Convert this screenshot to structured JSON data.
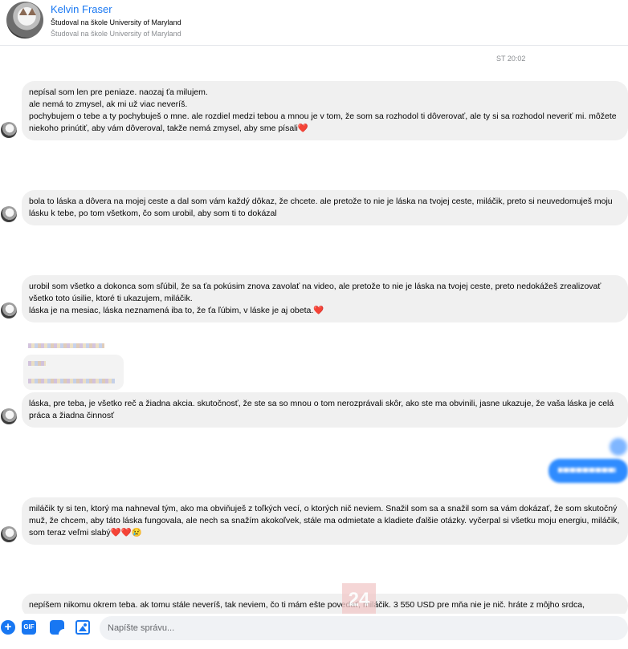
{
  "header": {
    "name": "Kelvin Fraser",
    "subtitle": "Študoval na škole University of Maryland",
    "subtitle_secondary": "Študoval na škole University of Maryland"
  },
  "timestamp": "ST 20:02",
  "messages": [
    {
      "lines": [
        "nepísal som len pre peniaze. naozaj ťa milujem.",
        "ale nemá to zmysel, ak mi už viac neveríš.",
        "pochybujem o tebe a ty pochybuješ o mne. ale rozdiel medzi tebou a mnou je v tom, že som sa rozhodol ti dôverovať, ale ty si sa rozhodol neveriť mi. môžete niekoho prinútiť, aby vám dôveroval, takže nemá zmysel, aby sme písali❤️"
      ]
    },
    {
      "lines": [
        "bola to láska a dôvera na mojej ceste a dal som vám každý dôkaz, že chcete. ale pretože to nie je láska na tvojej ceste, miláčik, preto si neuvedomuješ moju lásku k tebe, po tom všetkom, čo som urobil, aby som ti to dokázal"
      ]
    },
    {
      "lines": [
        "urobil som všetko a dokonca som sľúbil, že sa ťa pokúsim znova zavolať na video, ale pretože to nie je láska na tvojej ceste, preto nedokážeš zrealizovať všetko toto úsilie, ktoré ti ukazujem, miláčik.",
        "láska je na mesiac, láska neznamená iba to, že ťa ľúbim, v láske je aj obeta.❤️"
      ]
    },
    {
      "lines": [
        "láska, pre teba, je všetko reč a žiadna akcia. skutočnosť, že ste sa so mnou o tom nerozprávali skôr, ako ste ma obvinili, jasne ukazuje, že vaša láska je celá práca a žiadna činnosť"
      ]
    },
    {
      "lines": [
        "miláčik ty si ten, ktorý ma nahneval tým, ako ma obviňuješ z toľkých vecí, o ktorých nič neviem. Snažil som sa a snažil som sa vám dokázať, že som skutočný muž, že chcem, aby táto láska fungovala, ale nech sa snažím akokoľvek, stále ma odmietate a kladiete ďalšie otázky. vyčerpal si všetku moju energiu, miláčik, som teraz veľmi slabý❤️❤️😢"
      ]
    },
    {
      "lines": [
        "nepíšem nikomu okrem teba. ak tomu stále neveríš, tak neviem, čo ti mám ešte povedať, miláčik. 3 550 USD pre mňa nie je nič. hráte z môjho srdca,"
      ]
    }
  ],
  "watermark": "24",
  "composer": {
    "gif_label": "GIF",
    "plus_label": "+",
    "placeholder": "Napíšte správu..."
  },
  "icons": [
    "plus-icon",
    "gif-icon",
    "sticker-icon",
    "image-icon"
  ],
  "colors": {
    "accent": "#1877f2",
    "bubble_in": "#f0f0f0",
    "bubble_out": "#2f8cff"
  }
}
